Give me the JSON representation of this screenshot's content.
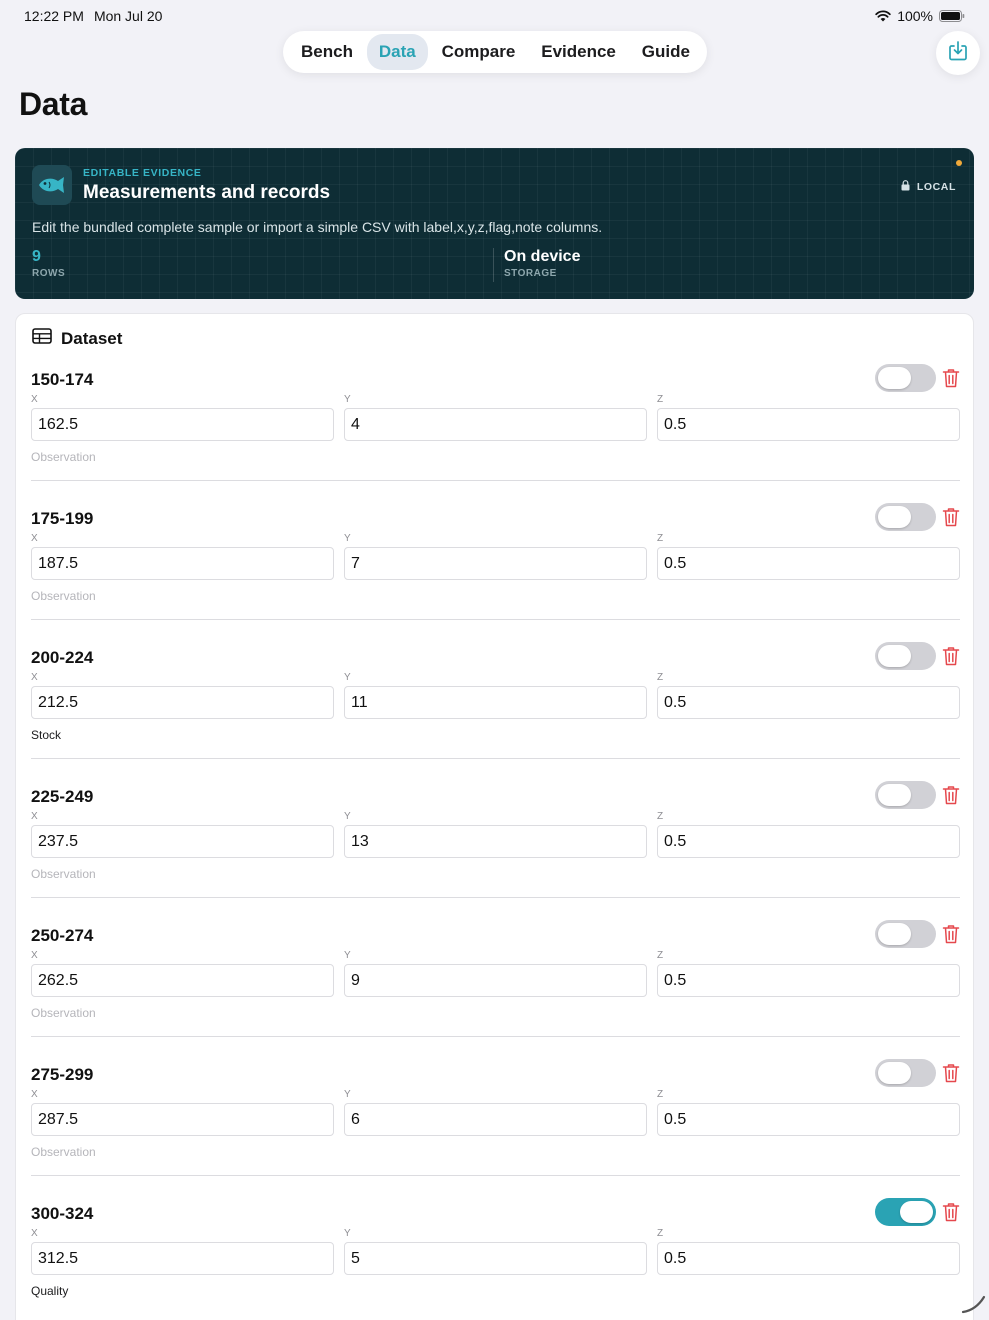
{
  "status_bar": {
    "time": "12:22 PM",
    "date": "Mon Jul 20",
    "battery": "100%"
  },
  "tabs": [
    {
      "label": "Bench",
      "active": false
    },
    {
      "label": "Data",
      "active": true
    },
    {
      "label": "Compare",
      "active": false
    },
    {
      "label": "Evidence",
      "active": false
    },
    {
      "label": "Guide",
      "active": false
    }
  ],
  "export_icon": "share-download-icon",
  "page_title": "Data",
  "banner": {
    "eyebrow": "EDITABLE EVIDENCE",
    "title": "Measurements and records",
    "badge": "LOCAL",
    "description": "Edit the bundled complete sample or import a simple CSV with label,x,y,z,flag,note columns.",
    "rows_value": "9",
    "rows_label": "ROWS",
    "storage_value": "On device",
    "storage_label": "STORAGE",
    "accent": "#37b5c6",
    "background": "#0e2d35"
  },
  "dataset": {
    "title": "Dataset",
    "field_labels": {
      "x": "X",
      "y": "Y",
      "z": "Z"
    },
    "rows": [
      {
        "label": "150-174",
        "x": "162.5",
        "y": "4",
        "z": "0.5",
        "note": "",
        "note_placeholder": "Observation",
        "flag": false
      },
      {
        "label": "175-199",
        "x": "187.5",
        "y": "7",
        "z": "0.5",
        "note": "",
        "note_placeholder": "Observation",
        "flag": false
      },
      {
        "label": "200-224",
        "x": "212.5",
        "y": "11",
        "z": "0.5",
        "note": "Stock",
        "note_placeholder": "Observation",
        "flag": false
      },
      {
        "label": "225-249",
        "x": "237.5",
        "y": "13",
        "z": "0.5",
        "note": "",
        "note_placeholder": "Observation",
        "flag": false
      },
      {
        "label": "250-274",
        "x": "262.5",
        "y": "9",
        "z": "0.5",
        "note": "",
        "note_placeholder": "Observation",
        "flag": false
      },
      {
        "label": "275-299",
        "x": "287.5",
        "y": "6",
        "z": "0.5",
        "note": "",
        "note_placeholder": "Observation",
        "flag": false
      },
      {
        "label": "300-324",
        "x": "312.5",
        "y": "5",
        "z": "0.5",
        "note": "Quality",
        "note_placeholder": "Observation",
        "flag": true
      }
    ]
  },
  "colors": {
    "accent": "#2aa3b4",
    "delete": "#e5484d",
    "toggle_off": "#d1d1d6"
  }
}
